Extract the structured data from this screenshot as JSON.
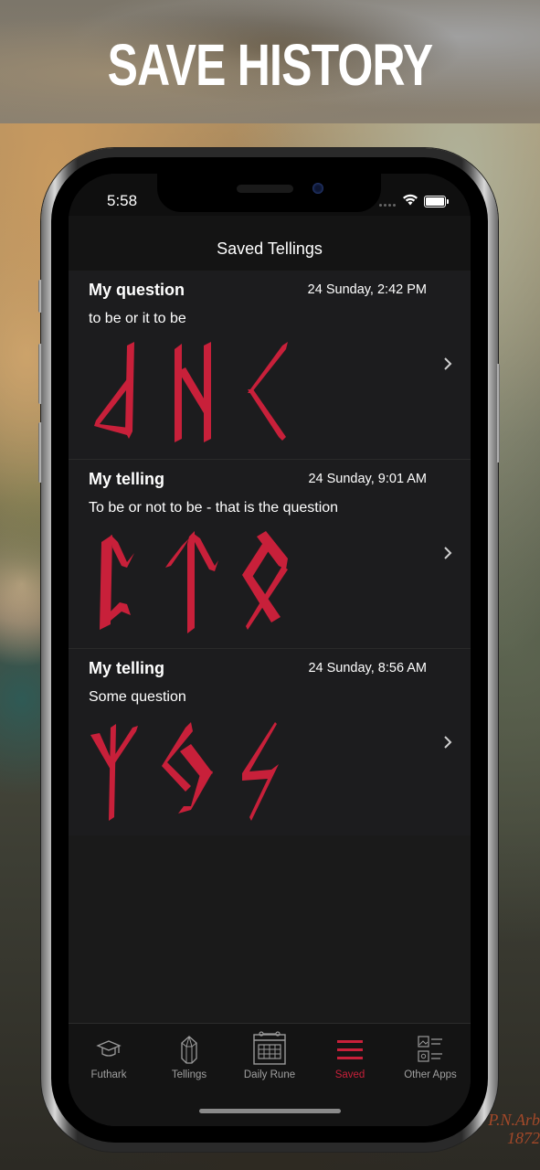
{
  "banner": {
    "headline": "SAVE HISTORY"
  },
  "painting_signature": "P.N.Arb\n1872",
  "status_bar": {
    "time": "5:58"
  },
  "nav": {
    "title": "Saved Tellings"
  },
  "accent_color": "#c8203a",
  "saved_tellings": [
    {
      "title": "My question",
      "date": "24 Sunday, 2:42 PM",
      "question": "to be or it to be",
      "runes": [
        "laguz-reversed-rune",
        "hagalaz-rune",
        "kenaz-rune"
      ]
    },
    {
      "title": "My telling",
      "date": "24 Sunday, 9:01 AM",
      "question": "To be or not to be - that is the question",
      "runes": [
        "perthro-rune",
        "tiwaz-rune",
        "othala-rune"
      ]
    },
    {
      "title": "My telling",
      "date": "24 Sunday, 8:56 AM",
      "question": "Some question",
      "runes": [
        "algiz-rune",
        "jera-rune",
        "sowilo-rune"
      ]
    }
  ],
  "tabbar": {
    "items": [
      {
        "label": "Futhark",
        "icon": "graduation-cap-icon",
        "active": false
      },
      {
        "label": "Tellings",
        "icon": "crystal-icon",
        "active": false
      },
      {
        "label": "Daily Rune",
        "icon": "calendar-icon",
        "active": false
      },
      {
        "label": "Saved",
        "icon": "list-icon",
        "active": true
      },
      {
        "label": "Other Apps",
        "icon": "apps-list-icon",
        "active": false
      }
    ]
  }
}
